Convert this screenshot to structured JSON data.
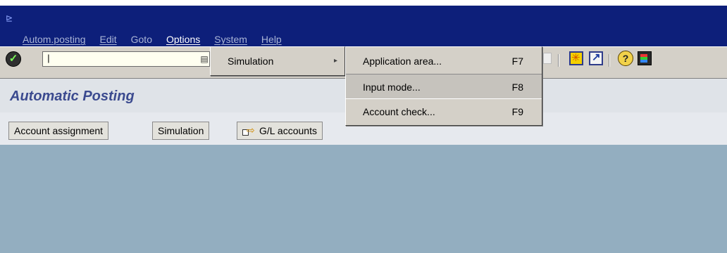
{
  "menubar": {
    "items": [
      {
        "label": "Autom.posting"
      },
      {
        "label": "Edit"
      },
      {
        "label": "Goto"
      },
      {
        "label": "Options"
      },
      {
        "label": "System"
      },
      {
        "label": "Help"
      }
    ]
  },
  "toolbar": {
    "command_field_value": "|",
    "icons": [
      "enter-checkmark-icon",
      "dropdown-icon",
      "create-session-icon",
      "generate-shortcut-icon",
      "help-icon",
      "layout-menu-icon"
    ]
  },
  "page": {
    "title": "Automatic Posting"
  },
  "appbar": {
    "buttons": [
      {
        "label": "Account assignment"
      },
      {
        "label": "Simulation"
      },
      {
        "label": "G/L accounts"
      }
    ]
  },
  "options_menu": {
    "items": [
      {
        "label": "Simulation"
      }
    ]
  },
  "simulation_submenu": {
    "items": [
      {
        "label": "Application area...",
        "shortcut": "F7"
      },
      {
        "label": "Input mode...",
        "shortcut": "F8"
      },
      {
        "label": "Account check...",
        "shortcut": "F9"
      }
    ]
  },
  "colors": {
    "titlebar": "#0d1f7a",
    "title_text": "#3b4a8f",
    "content_bg": "#93aec0",
    "menu_bg": "#d4d0c8"
  }
}
